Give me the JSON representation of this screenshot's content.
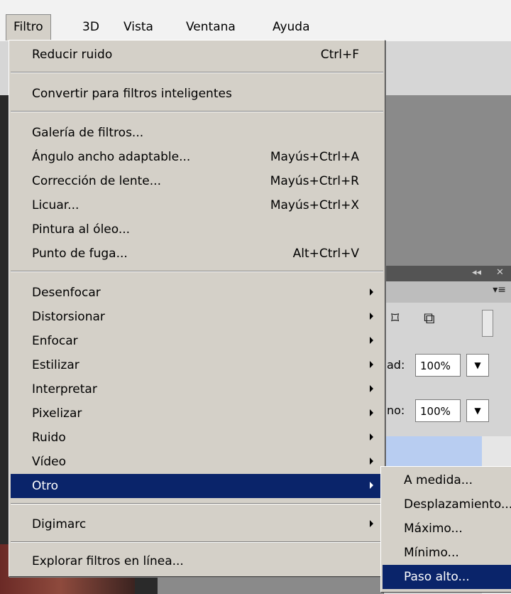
{
  "menubar": {
    "items": [
      "Filtro",
      "3D",
      "Vista",
      "Ventana",
      "Ayuda"
    ]
  },
  "filter_menu": {
    "groups": [
      [
        {
          "label": "Reducir ruido",
          "shortcut": "Ctrl+F"
        }
      ],
      [
        {
          "label": "Convertir para filtros inteligentes"
        }
      ],
      [
        {
          "label": "Galería de filtros..."
        },
        {
          "label": "Ángulo ancho adaptable...",
          "shortcut": "Mayús+Ctrl+A"
        },
        {
          "label": "Corrección de lente...",
          "shortcut": "Mayús+Ctrl+R"
        },
        {
          "label": "Licuar...",
          "shortcut": "Mayús+Ctrl+X"
        },
        {
          "label": "Pintura al óleo..."
        },
        {
          "label": "Punto de fuga...",
          "shortcut": "Alt+Ctrl+V"
        }
      ],
      [
        {
          "label": "Desenfocar",
          "submenu": true
        },
        {
          "label": "Distorsionar",
          "submenu": true
        },
        {
          "label": "Enfocar",
          "submenu": true
        },
        {
          "label": "Estilizar",
          "submenu": true
        },
        {
          "label": "Interpretar",
          "submenu": true
        },
        {
          "label": "Pixelizar",
          "submenu": true
        },
        {
          "label": "Ruido",
          "submenu": true
        },
        {
          "label": "Vídeo",
          "submenu": true
        },
        {
          "label": "Otro",
          "submenu": true,
          "highlighted": true
        }
      ],
      [
        {
          "label": "Digimarc",
          "submenu": true
        }
      ],
      [
        {
          "label": "Explorar filtros en línea..."
        }
      ]
    ]
  },
  "submenu_otro": {
    "items": [
      {
        "label": "A medida..."
      },
      {
        "label": "Desplazamiento..."
      },
      {
        "label": "Máximo..."
      },
      {
        "label": "Mínimo..."
      },
      {
        "label": "Paso alto...",
        "highlighted": true
      }
    ]
  },
  "layers_panel": {
    "opacity_label": "ad:",
    "opacity_value": "100%",
    "fill_label": "no:",
    "fill_value": "100%",
    "collapse_glyph": "◂◂",
    "close_glyph": "✕",
    "panel_menu_glyph": "▾≡",
    "dropdown_glyph": "▼"
  },
  "colors": {
    "menu_bg": "#d4d0c8",
    "highlight": "#0a246a",
    "highlight_text": "#ffffff"
  }
}
